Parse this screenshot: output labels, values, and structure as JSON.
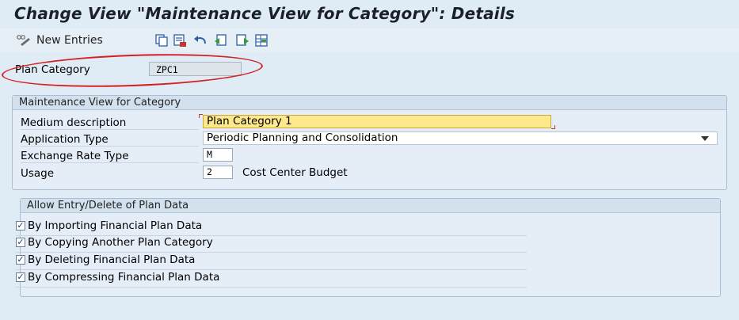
{
  "window": {
    "title": "Change View \"Maintenance View for Category\": Details"
  },
  "toolbar": {
    "new_entries_label": "New Entries",
    "icons": [
      "display-change-icon",
      "copy-icon",
      "delete-icon",
      "undo-icon",
      "previous-entry-icon",
      "next-entry-icon",
      "select-all-icon"
    ]
  },
  "header_field": {
    "label": "Plan Category",
    "value": "ZPC1"
  },
  "annotation": {
    "color": "#d42020"
  },
  "maintenance_group": {
    "title": "Maintenance View for Category",
    "medium_description": {
      "label": "Medium description",
      "value": "Plan Category 1"
    },
    "application_type": {
      "label": "Application Type",
      "value": "Periodic Planning and Consolidation"
    },
    "exchange_rate_type": {
      "label": "Exchange Rate Type",
      "value": "M"
    },
    "usage": {
      "label": "Usage",
      "value": "2",
      "text": "Cost Center Budget"
    }
  },
  "plan_data_group": {
    "title": "Allow Entry/Delete of Plan Data",
    "checkboxes": [
      {
        "label": "By Importing Financial Plan Data",
        "checked": true
      },
      {
        "label": "By Copying Another Plan Category",
        "checked": true
      },
      {
        "label": "By Deleting Financial Plan Data",
        "checked": true
      },
      {
        "label": "By Compressing Financial Plan Data",
        "checked": true
      }
    ]
  },
  "colors": {
    "focus_field": "#fde98b",
    "background": "#dfebf5"
  }
}
